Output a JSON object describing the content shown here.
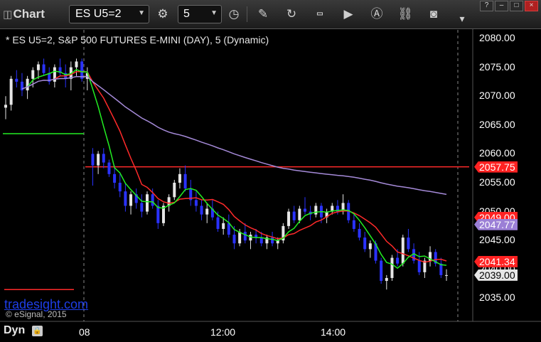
{
  "toolbar": {
    "title": "Chart",
    "symbol": "ES U5=2",
    "interval": "5"
  },
  "chart_data": {
    "type": "candlestick",
    "title": "* ES U5=2, S&P 500 FUTURES E-MINI (DAY), 5 (Dynamic)",
    "y_ticks": [
      "2080.00",
      "2075.00",
      "2070.00",
      "2065.00",
      "2060.00",
      "2055.00",
      "2050.00",
      "2045.00",
      "2040.00",
      "2035.00"
    ],
    "y_range": [
      2032.5,
      2082.5
    ],
    "x_ticks": [
      "08",
      "12:00",
      "14:00"
    ],
    "price_tags": [
      {
        "label": "2057.75",
        "value": 2057.75,
        "bg": "#ff2222",
        "fg": "#ffffff"
      },
      {
        "label": "2049.00",
        "value": 2049.0,
        "bg": "#ff2222",
        "fg": "#ffffff"
      },
      {
        "label": "2047.77",
        "value": 2047.77,
        "bg": "#9b7fd6",
        "fg": "#ffffff"
      },
      {
        "label": "2041.34",
        "value": 2041.34,
        "bg": "#ff2222",
        "fg": "#ffffff"
      },
      {
        "label": "2039.00",
        "value": 2039.0,
        "bg": "#e6e6e6",
        "fg": "#000000"
      }
    ],
    "colors": {
      "up": "#e6e6e6",
      "down": "#2a32ff",
      "ma_red": "#ff2a2a",
      "ma_green": "#22ee22",
      "vwap": "#a58ad8"
    },
    "candles": [
      [
        2068.0,
        2070.0,
        2066.0,
        2068.5
      ],
      [
        2068.5,
        2073.5,
        2067.5,
        2073.0
      ],
      [
        2073.0,
        2074.5,
        2071.5,
        2072.5
      ],
      [
        2072.5,
        2074.0,
        2070.0,
        2071.0
      ],
      [
        2071.0,
        2073.5,
        2069.5,
        2073.0
      ],
      [
        2073.0,
        2075.0,
        2071.5,
        2074.5
      ],
      [
        2074.5,
        2076.0,
        2073.0,
        2075.5
      ],
      [
        2075.5,
        2076.5,
        2073.5,
        2074.0
      ],
      [
        2074.0,
        2075.0,
        2072.0,
        2072.5
      ],
      [
        2072.5,
        2075.5,
        2071.5,
        2075.0
      ],
      [
        2075.0,
        2076.5,
        2073.5,
        2074.0
      ],
      [
        2074.0,
        2075.5,
        2071.5,
        2073.0
      ],
      [
        2073.0,
        2076.0,
        2071.0,
        2075.0
      ],
      [
        2075.0,
        2076.5,
        2073.5,
        2076.0
      ],
      [
        2076.0,
        2076.5,
        2072.5,
        2073.0
      ],
      [
        2073.0,
        2075.0,
        2071.0,
        2074.0
      ],
      [
        2060.0,
        2061.0,
        2054.5,
        2058.0
      ],
      [
        2058.0,
        2060.5,
        2056.5,
        2060.0
      ],
      [
        2060.0,
        2061.0,
        2057.5,
        2058.5
      ],
      [
        2058.5,
        2059.0,
        2056.0,
        2056.5
      ],
      [
        2056.5,
        2058.0,
        2054.0,
        2055.0
      ],
      [
        2055.0,
        2056.5,
        2052.5,
        2053.5
      ],
      [
        2053.5,
        2055.0,
        2050.0,
        2051.0
      ],
      [
        2051.0,
        2053.5,
        2049.5,
        2053.0
      ],
      [
        2053.0,
        2054.0,
        2050.5,
        2051.5
      ],
      [
        2051.5,
        2053.0,
        2049.0,
        2050.0
      ],
      [
        2050.0,
        2053.5,
        2049.5,
        2053.0
      ],
      [
        2053.0,
        2054.0,
        2050.5,
        2051.0
      ],
      [
        2051.0,
        2052.0,
        2047.0,
        2048.0
      ],
      [
        2048.0,
        2051.5,
        2047.5,
        2051.0
      ],
      [
        2051.0,
        2053.0,
        2050.0,
        2052.5
      ],
      [
        2052.5,
        2055.5,
        2052.0,
        2055.0
      ],
      [
        2055.0,
        2057.5,
        2054.0,
        2056.5
      ],
      [
        2056.5,
        2058.0,
        2053.5,
        2054.0
      ],
      [
        2054.0,
        2055.5,
        2051.0,
        2052.0
      ],
      [
        2052.0,
        2053.5,
        2050.0,
        2051.0
      ],
      [
        2051.0,
        2052.0,
        2048.5,
        2049.5
      ],
      [
        2049.5,
        2051.5,
        2048.0,
        2050.5
      ],
      [
        2050.5,
        2052.0,
        2048.5,
        2049.0
      ],
      [
        2049.0,
        2050.0,
        2046.5,
        2047.0
      ],
      [
        2047.0,
        2049.0,
        2046.0,
        2048.0
      ],
      [
        2048.0,
        2049.5,
        2045.5,
        2046.0
      ],
      [
        2046.0,
        2047.5,
        2043.5,
        2044.5
      ],
      [
        2044.5,
        2047.0,
        2044.0,
        2046.5
      ],
      [
        2046.5,
        2048.0,
        2044.5,
        2045.0
      ],
      [
        2045.0,
        2046.5,
        2043.5,
        2046.0
      ],
      [
        2046.0,
        2047.0,
        2044.5,
        2045.5
      ],
      [
        2045.5,
        2046.5,
        2044.0,
        2044.5
      ],
      [
        2044.5,
        2046.0,
        2043.5,
        2045.5
      ],
      [
        2045.5,
        2046.5,
        2044.0,
        2044.5
      ],
      [
        2044.5,
        2045.5,
        2043.5,
        2045.0
      ],
      [
        2045.0,
        2048.0,
        2044.5,
        2047.5
      ],
      [
        2047.5,
        2050.5,
        2047.0,
        2050.0
      ],
      [
        2050.0,
        2051.0,
        2048.0,
        2048.5
      ],
      [
        2048.5,
        2051.0,
        2048.0,
        2050.5
      ],
      [
        2050.5,
        2052.5,
        2049.5,
        2050.0
      ],
      [
        2050.0,
        2051.0,
        2048.5,
        2049.5
      ],
      [
        2049.5,
        2051.5,
        2049.0,
        2051.0
      ],
      [
        2051.0,
        2051.5,
        2048.0,
        2049.0
      ],
      [
        2049.0,
        2050.5,
        2048.0,
        2050.0
      ],
      [
        2050.0,
        2051.5,
        2049.5,
        2051.0
      ],
      [
        2051.0,
        2052.0,
        2049.5,
        2050.0
      ],
      [
        2050.0,
        2053.0,
        2049.5,
        2051.5
      ],
      [
        2051.5,
        2052.0,
        2048.0,
        2048.5
      ],
      [
        2048.5,
        2049.5,
        2046.5,
        2047.0
      ],
      [
        2047.0,
        2048.0,
        2045.0,
        2045.5
      ],
      [
        2045.5,
        2046.5,
        2043.0,
        2043.5
      ],
      [
        2043.5,
        2045.0,
        2042.0,
        2044.5
      ],
      [
        2044.5,
        2045.0,
        2041.0,
        2041.5
      ],
      [
        2041.5,
        2042.0,
        2037.5,
        2038.0
      ],
      [
        2038.0,
        2039.0,
        2036.5,
        2038.5
      ],
      [
        2038.5,
        2042.5,
        2038.0,
        2042.0
      ],
      [
        2042.0,
        2043.5,
        2040.5,
        2041.0
      ],
      [
        2041.0,
        2046.0,
        2040.5,
        2045.5
      ],
      [
        2045.5,
        2047.0,
        2043.0,
        2043.5
      ],
      [
        2043.5,
        2044.5,
        2041.0,
        2041.5
      ],
      [
        2041.5,
        2043.0,
        2039.0,
        2039.5
      ],
      [
        2039.5,
        2042.0,
        2038.5,
        2041.5
      ],
      [
        2041.5,
        2044.0,
        2040.5,
        2043.0
      ],
      [
        2043.0,
        2043.5,
        2040.5,
        2041.0
      ],
      [
        2041.0,
        2042.0,
        2038.5,
        2039.0
      ],
      [
        2039.0,
        2040.0,
        2038.0,
        2039.0
      ]
    ]
  }
}
